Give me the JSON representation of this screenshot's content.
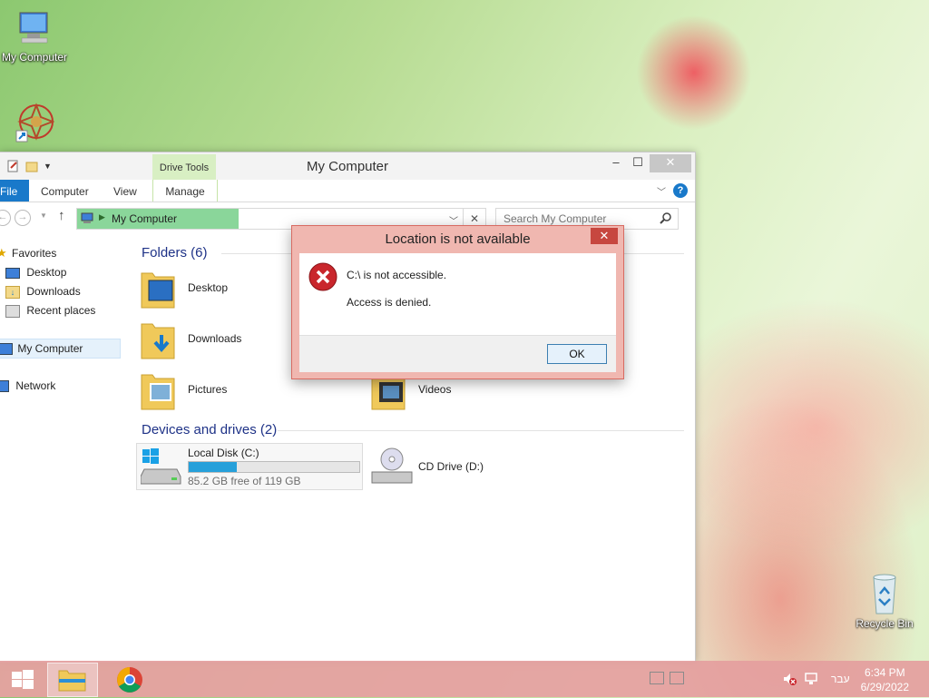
{
  "desktop": {
    "icons": [
      {
        "label": "My Computer"
      },
      {
        "label": "Recycle Bin"
      }
    ]
  },
  "explorer": {
    "title": "My Computer",
    "contextual_tab": "Drive Tools",
    "ribbon_tabs": [
      "File",
      "Computer",
      "View",
      "Manage"
    ],
    "address": "My Computer",
    "search_placeholder": "Search My Computer",
    "nav": {
      "favorites": "Favorites",
      "desktop": "Desktop",
      "downloads": "Downloads",
      "recent": "Recent places",
      "computer": "My Computer",
      "network": "Network"
    },
    "folders_heading": "Folders (6)",
    "folders": [
      "Desktop",
      "Downloads",
      "Pictures",
      "Videos"
    ],
    "drives_heading": "Devices and drives (2)",
    "drives": [
      {
        "name": "Local Disk (C:)",
        "free_text": "85.2 GB free of 119 GB",
        "used_fraction": 0.284
      },
      {
        "name": "CD Drive (D:)"
      }
    ]
  },
  "dialog": {
    "title": "Location is not available",
    "line1": "C:\\ is not accessible.",
    "line2": "Access is denied.",
    "ok": "OK"
  },
  "taskbar": {
    "language": "עבר",
    "time": "6:34 PM",
    "date": "6/29/2022"
  }
}
